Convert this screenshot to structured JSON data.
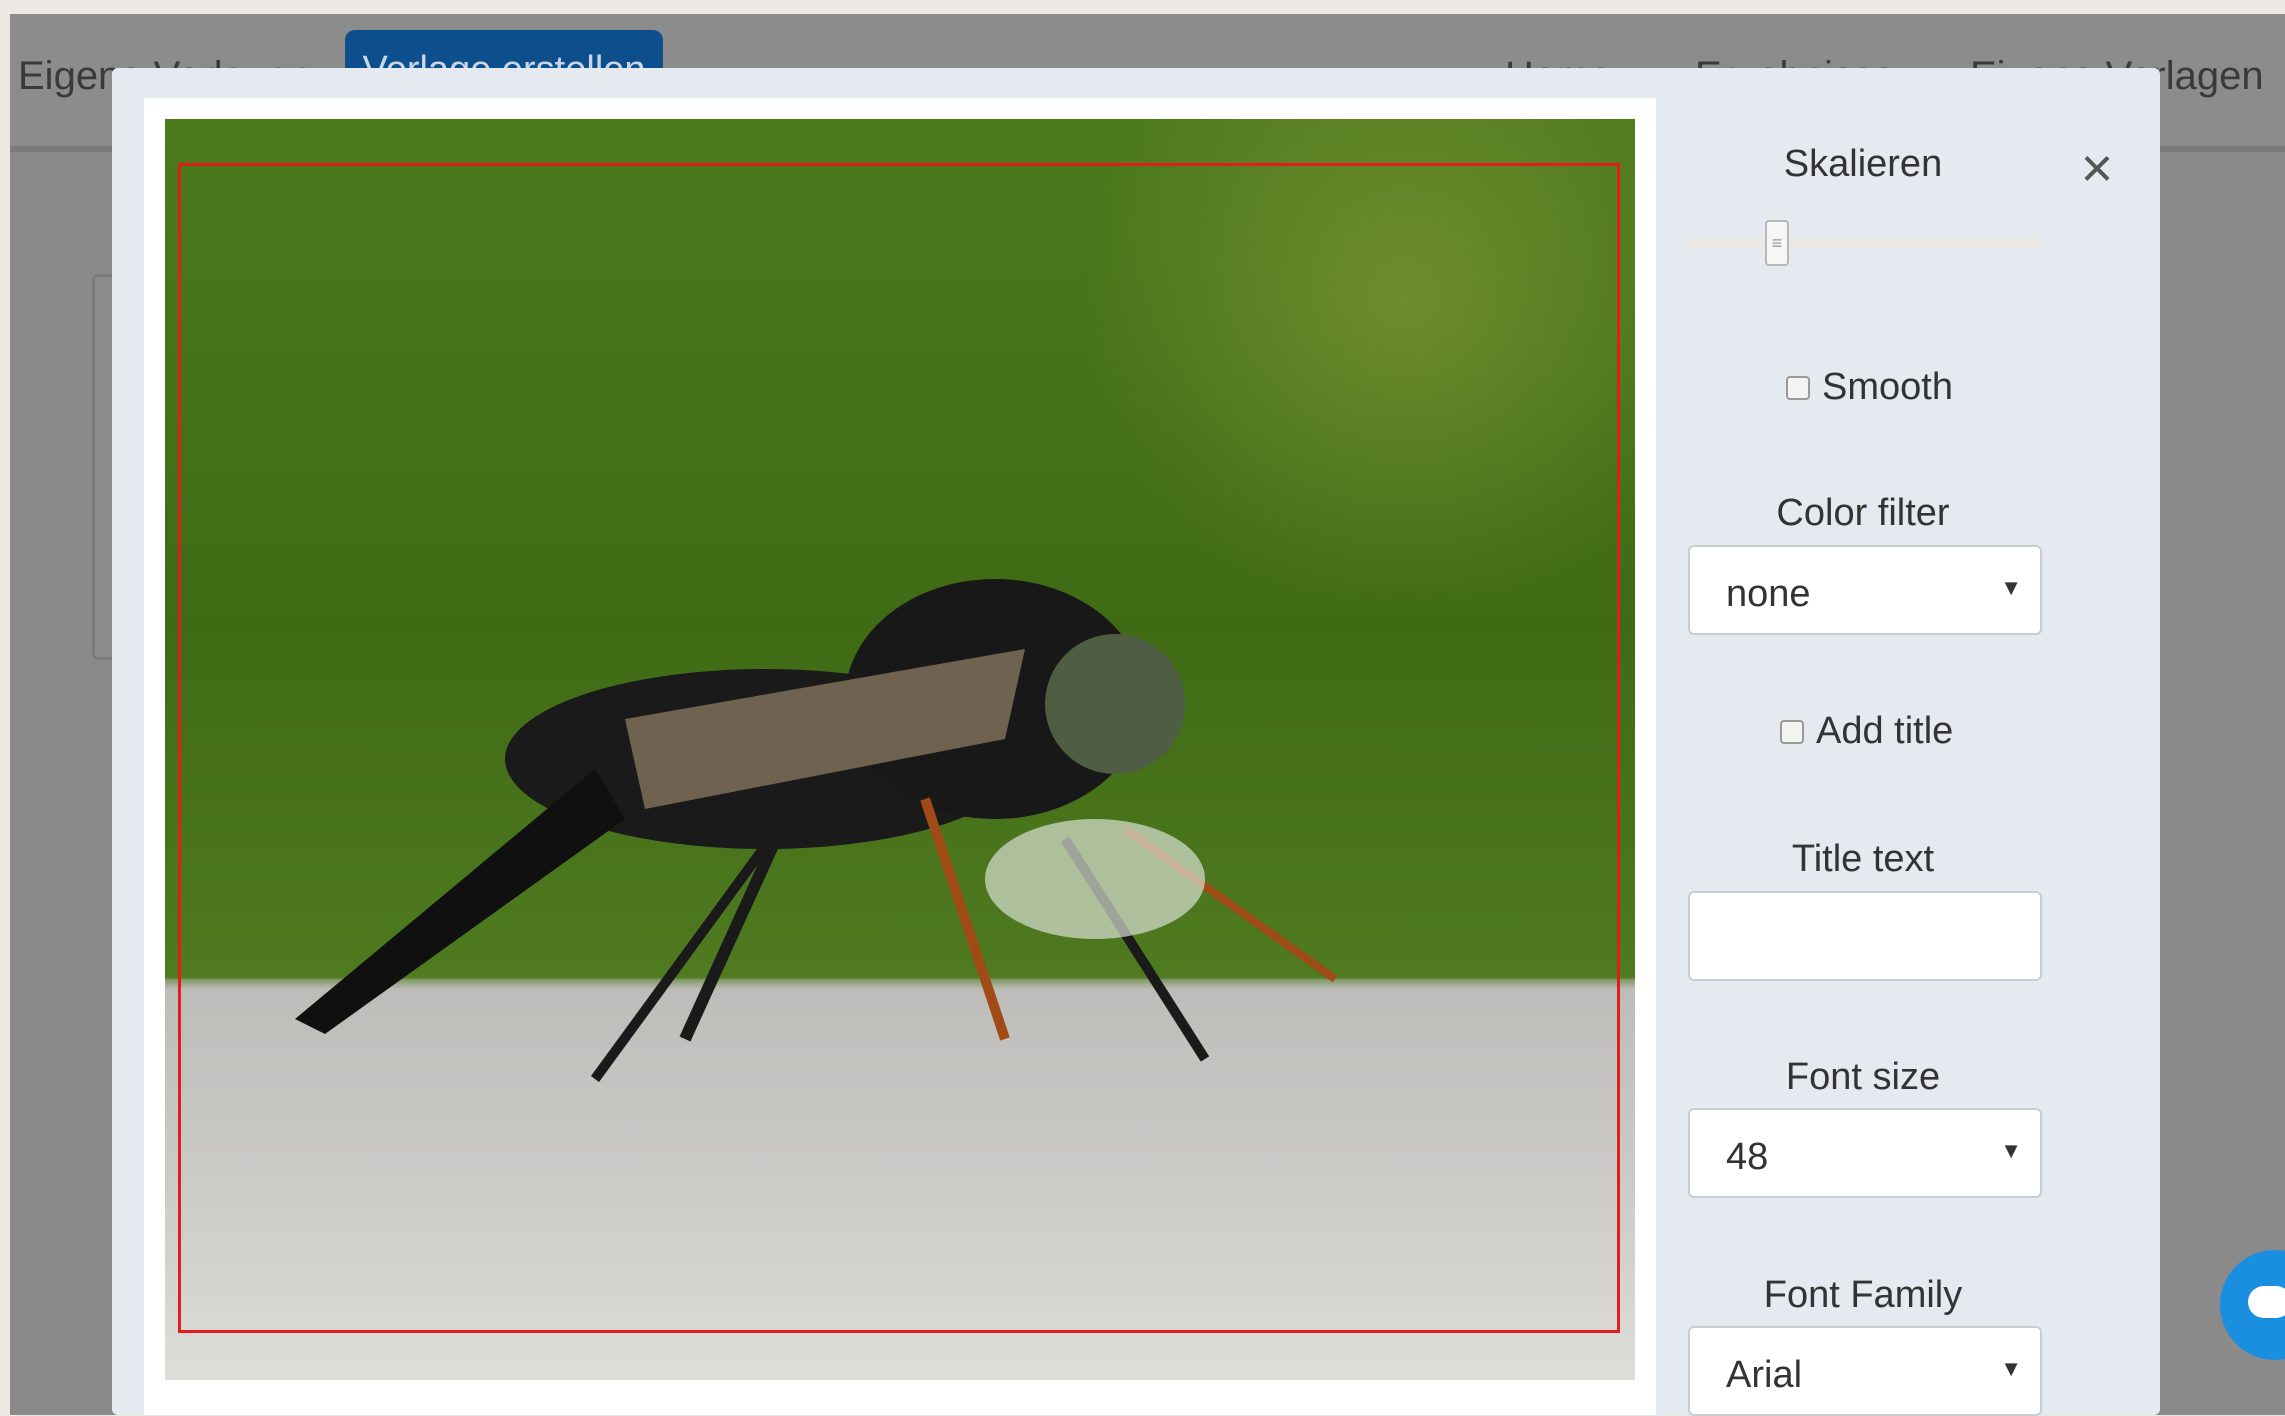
{
  "nav": {
    "left_link": "Eigene Vorlagen",
    "create_button": "Vorlage erstellen",
    "right_links": [
      "Home",
      "Ergebnisse",
      "Eigene Vorlagen"
    ]
  },
  "panel": {
    "scale_label": "Skalieren",
    "scale_value": 0.25,
    "smooth_label": "Smooth",
    "smooth_checked": false,
    "color_filter_label": "Color filter",
    "color_filter_value": "none",
    "add_title_label": "Add title",
    "add_title_checked": false,
    "title_text_label": "Title text",
    "title_text_value": "",
    "font_size_label": "Font size",
    "font_size_value": "48",
    "font_family_label": "Font Family",
    "font_family_value": "Arial",
    "close_icon": "close-icon"
  },
  "colors": {
    "crop_border": "#e21d1d",
    "nav_button": "#0d4e8c",
    "chat_bubble": "#1a8fe0"
  },
  "icons": {
    "chat": "chat-icon",
    "dropdown": "chevron-down-icon"
  }
}
